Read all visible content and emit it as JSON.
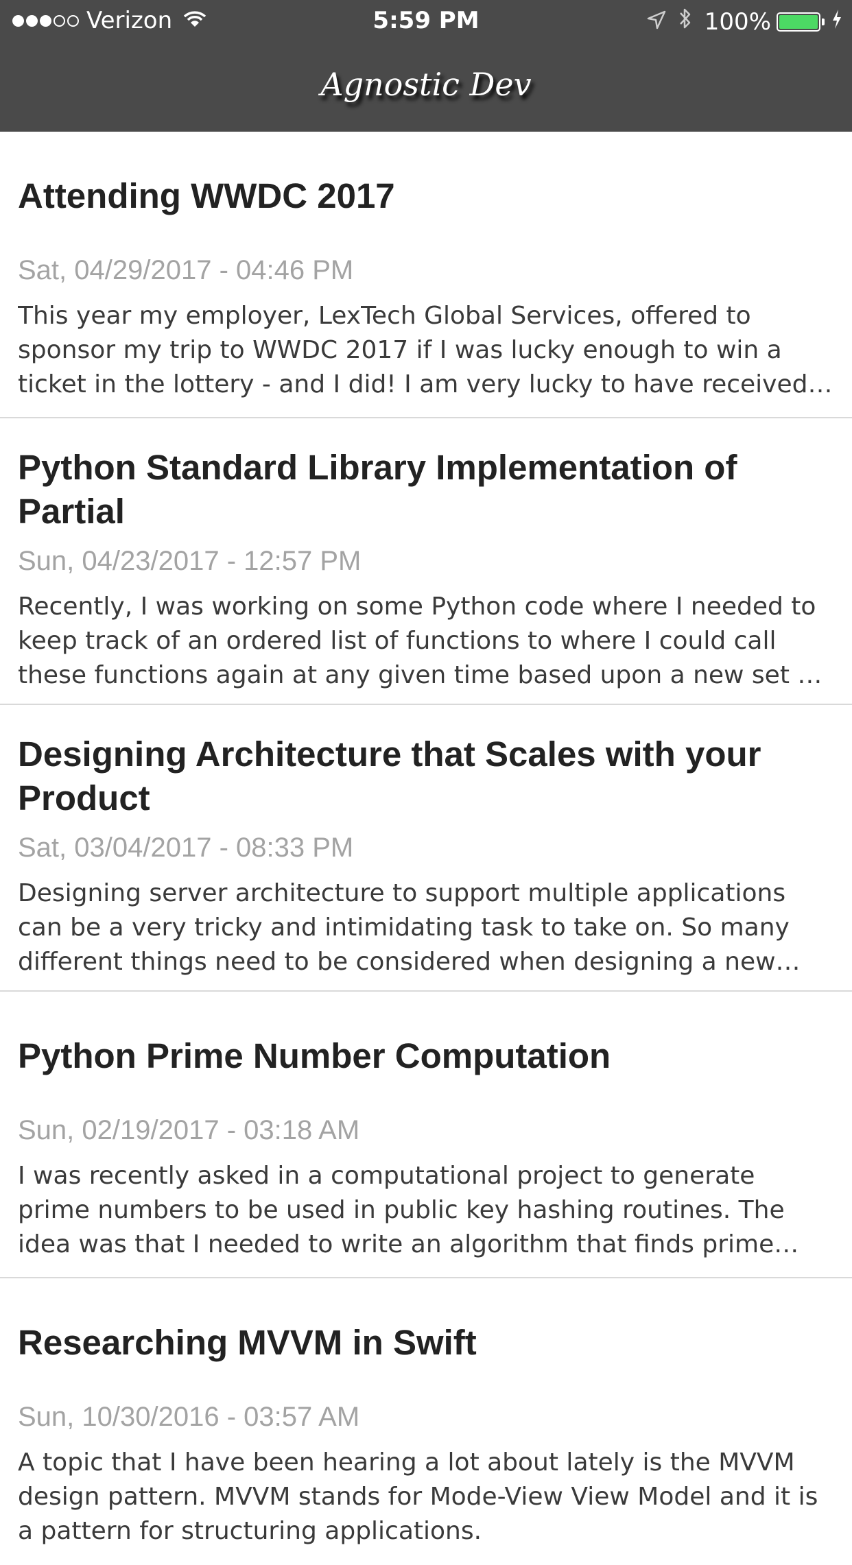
{
  "status_bar": {
    "carrier": "Verizon",
    "time": "5:59 PM",
    "battery_percent": "100%",
    "battery_level": 1.0,
    "signal_bars_full": 3,
    "signal_bars_total": 5,
    "battery_color": "#4cd964",
    "icons": [
      "signal-icon",
      "wifi-icon",
      "location-icon",
      "bluetooth-icon",
      "battery-icon",
      "charging-icon"
    ]
  },
  "nav": {
    "title": "Agnostic Dev",
    "background": "#4a4a4a"
  },
  "posts": [
    {
      "title": "Attending WWDC 2017",
      "date": "Sat, 04/29/2017 - 04:46 PM",
      "excerpt": "This year my employer, LexTech Global Services, offered to sponsor my trip to WWDC 2017 if I was lucky enough to win a ticket in the lottery - and I did!  I am very lucky to have received this opportunity."
    },
    {
      "title": "Python Standard Library Implementation of Partial",
      "date": "Sun, 04/23/2017 - 12:57 PM",
      "excerpt": "Recently, I was working on some Python code where I needed to keep track of an ordered list of functions to where I could call these functions again at any given time based upon a new set of conditions."
    },
    {
      "title": "Designing Architecture that Scales with your Product",
      "date": "Sat, 03/04/2017 - 08:33 PM",
      "excerpt": "Designing server architecture to support multiple applications can be a very tricky and intimidating task to take on.  So many different things need to be considered when designing a new system."
    },
    {
      "title": "Python Prime Number Computation",
      "date": "Sun, 02/19/2017 - 03:18 AM",
      "excerpt": "I was recently asked in a computational project to generate prime numbers to be used in public key hashing routines.  The idea was that I needed to write an algorithm that finds prime numbers quickly."
    },
    {
      "title": "Researching MVVM in Swift",
      "date": "Sun, 10/30/2016 - 03:57 AM",
      "excerpt": "A topic that I have been hearing a lot about lately is the MVVM design pattern.  MVVM stands for Mode-View View Model and it is a pattern for structuring applications."
    }
  ]
}
